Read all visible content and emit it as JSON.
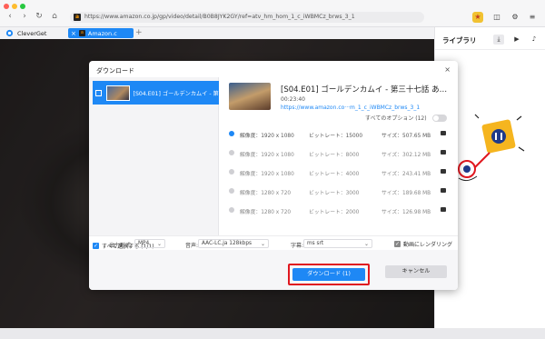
{
  "browser": {
    "url": "https://www.amazon.co.jp/gp/video/detail/B0B8JYK2GY/ref=atv_hm_hom_1_c_iWBMCz_brws_3_1",
    "url_favicon": "a",
    "colors": {
      "accent": "#1e88f5",
      "highlight": "#e0171f"
    }
  },
  "tabs": {
    "home_label": "CleverGet",
    "active_label": "Amazon.c",
    "active_favicon": "a",
    "add_label": "+"
  },
  "library": {
    "title": "ライブラリ"
  },
  "dialog": {
    "title": "ダウンロード",
    "close": "×",
    "left_item_label": "[S04.E01] ゴールデンカムイ - 第",
    "select_all_label": "すべて選択する (1/1)",
    "video_title": "[S04.E01] ゴールデンカムイ - 第三十七話 あ…",
    "duration": "00:23:40",
    "url": "https://www.amazon.co···m_1_c_iWBMCz_brws_3_1",
    "all_options_label": "すべてのオプション (12)",
    "options": [
      {
        "res": "解像度：1920 x 1080",
        "rate": "ビットレート：15000",
        "size": "サイズ：507.65 MB",
        "selected": true
      },
      {
        "res": "解像度：1920 x 1080",
        "rate": "ビットレート：8000",
        "size": "サイズ：302.12 MB",
        "selected": false
      },
      {
        "res": "解像度：1920 x 1080",
        "rate": "ビットレート：4000",
        "size": "サイズ：243.41 MB",
        "selected": false
      },
      {
        "res": "解像度：1280 x 720",
        "rate": "ビットレート：3000",
        "size": "サイズ：189.68 MB",
        "selected": false
      },
      {
        "res": "解像度：1280 x 720",
        "rate": "ビットレート：2000",
        "size": "サイズ：126.98 MB",
        "selected": false
      }
    ],
    "settings": {
      "format_label": "出力形式:",
      "format_value": "MP4",
      "audio_label": "音声:",
      "audio_value": "AAC-LC,ja 128kbps",
      "subtitle_label": "字幕:",
      "subtitle_value": "ms srt",
      "render_label": "動画にレンダリング"
    },
    "download_button": "ダウンロード (1)",
    "cancel_button": "キャンセル"
  }
}
